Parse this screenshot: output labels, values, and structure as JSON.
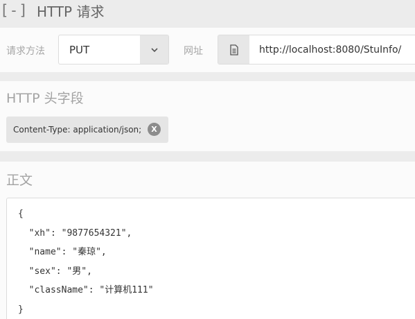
{
  "section": {
    "toggle": "[-]",
    "title": "HTTP 请求"
  },
  "request": {
    "method_label": "请求方法",
    "method_value": "PUT",
    "url_label": "网址",
    "url_value": "http://localhost:8080/StuInfo/"
  },
  "headers": {
    "title": "HTTP 头字段",
    "items": [
      {
        "text": "Content-Type: application/json;",
        "remove": "X"
      }
    ]
  },
  "body": {
    "title": "正文",
    "lines": [
      "{",
      "  \"xh\": \"9877654321\",",
      "  \"name\": \"秦琼\",",
      "  \"sex\": \"男\",",
      "  \"className\": \"计算机111\"",
      "}"
    ]
  },
  "icons": {
    "method_caret": "chevron-down-icon",
    "url_icon": "document-icon"
  }
}
